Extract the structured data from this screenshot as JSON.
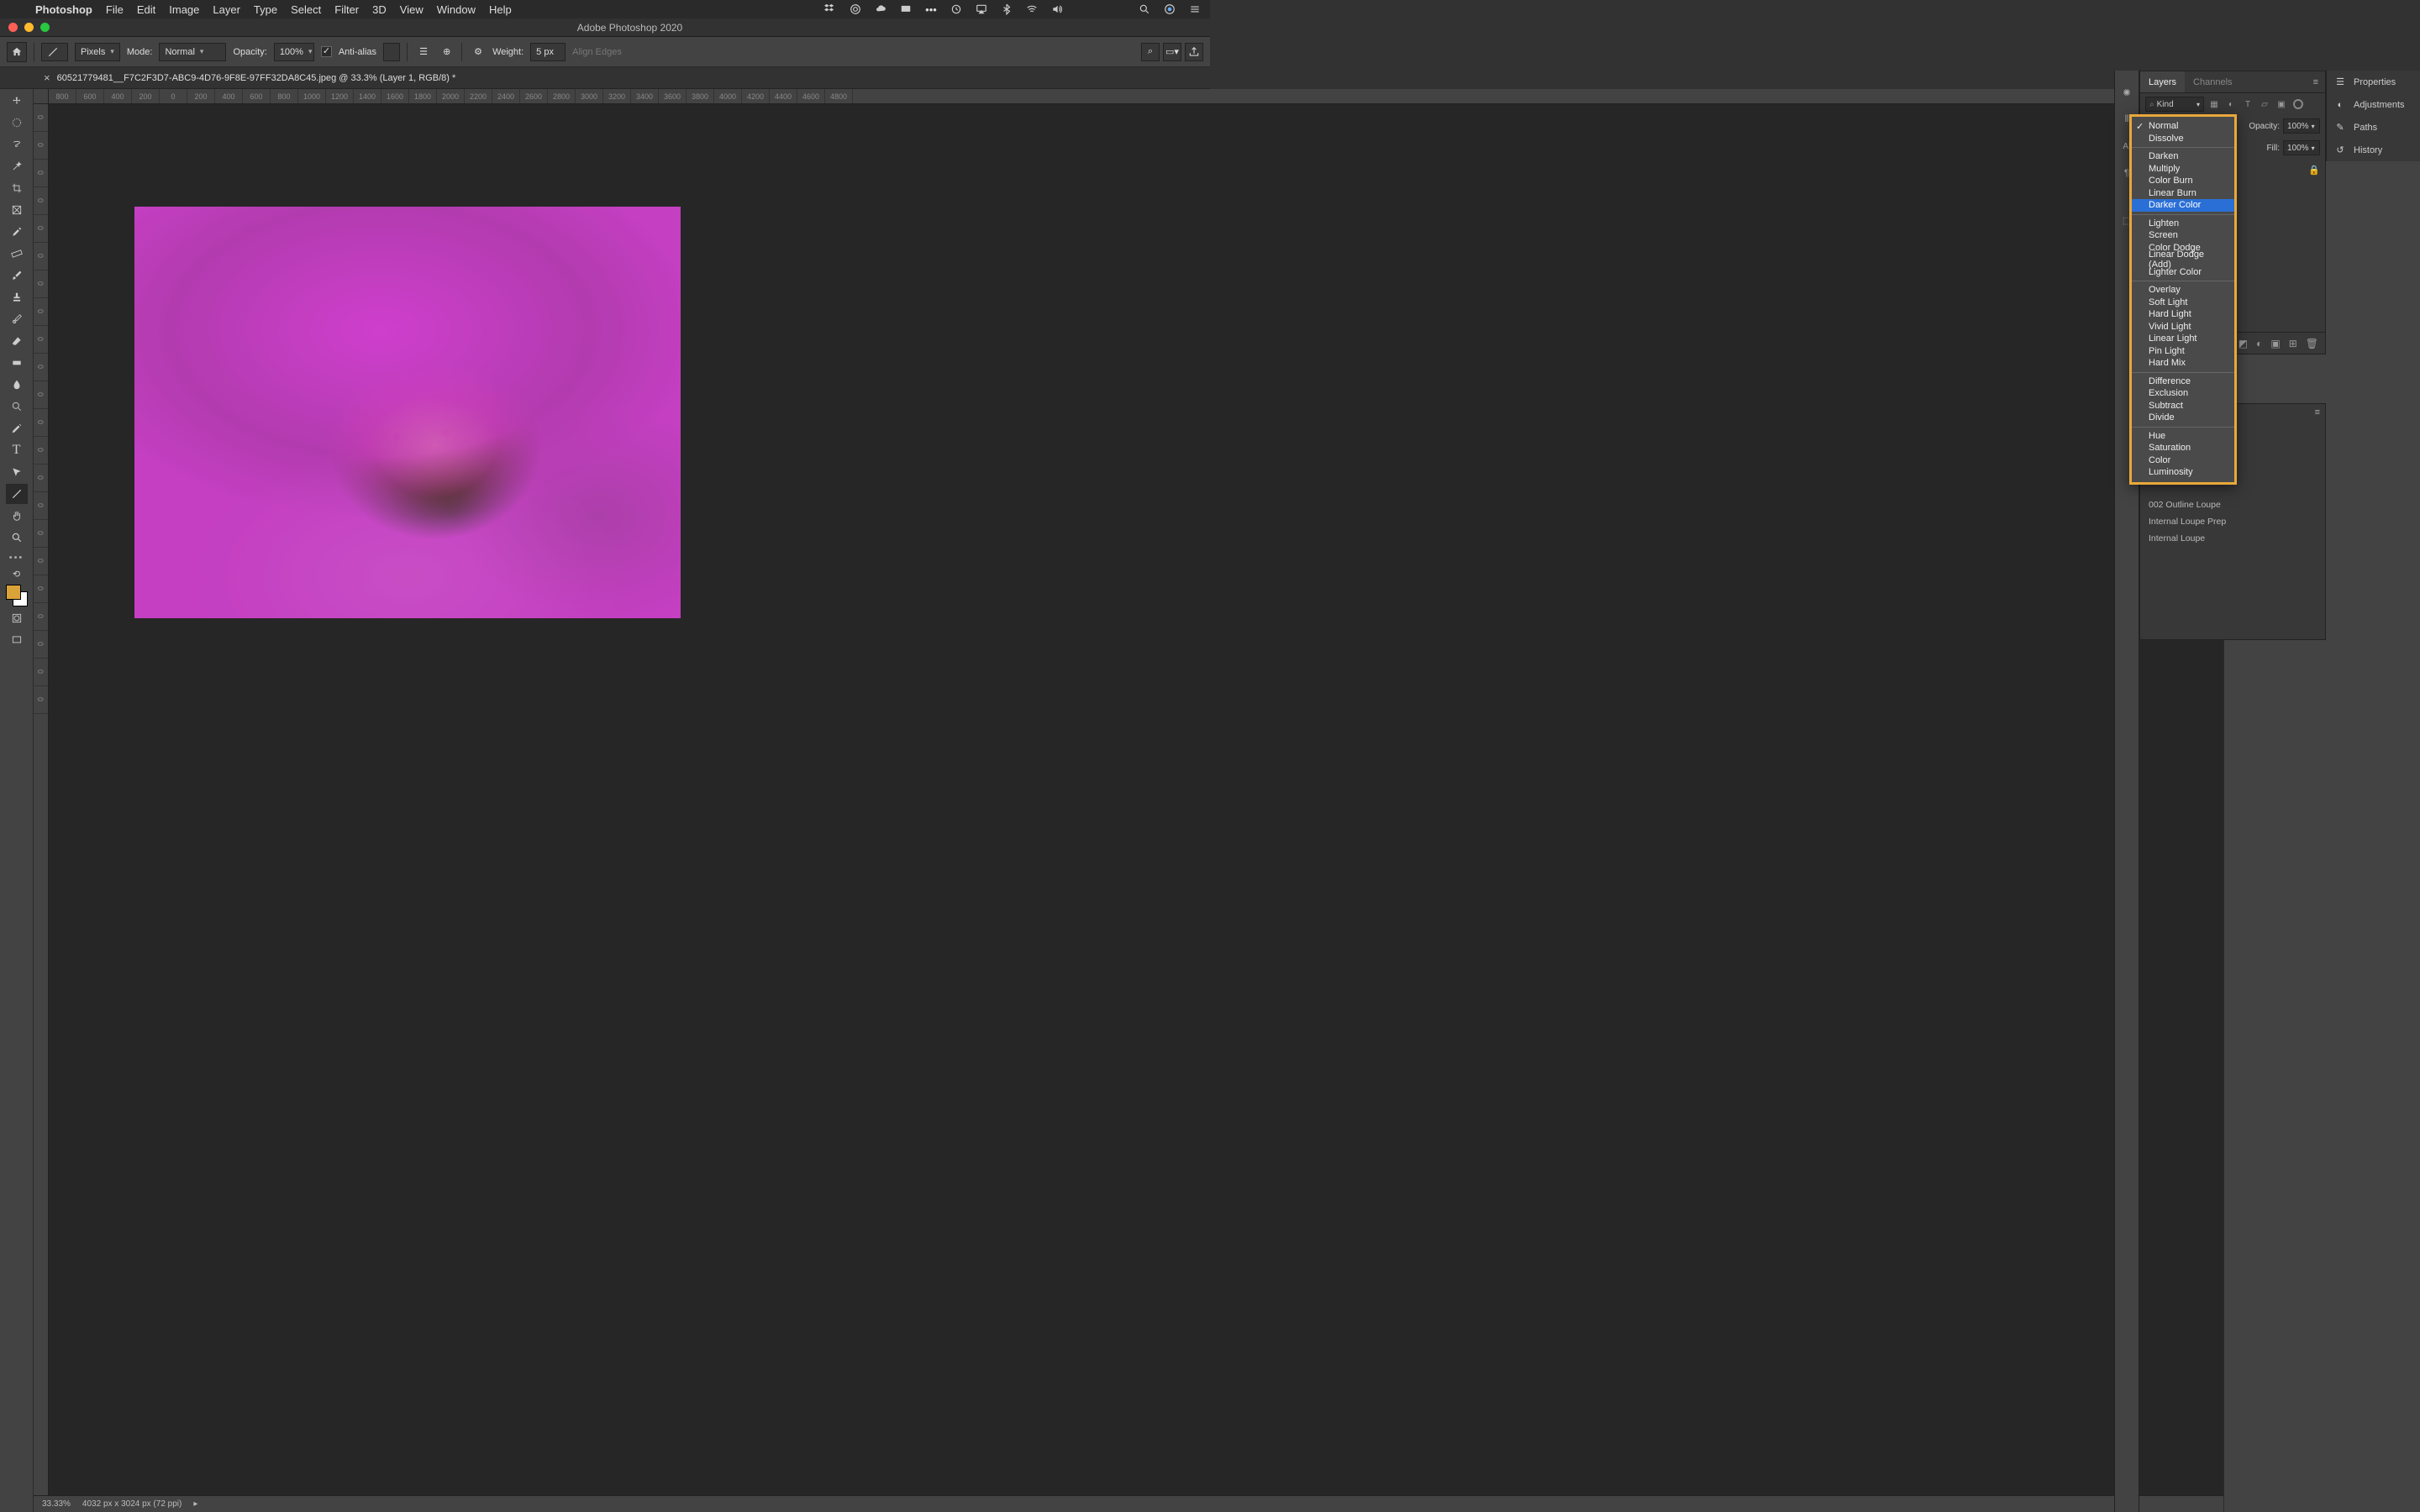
{
  "menubar": {
    "app": "Photoshop",
    "items": [
      "File",
      "Edit",
      "Image",
      "Layer",
      "Type",
      "Select",
      "Filter",
      "3D",
      "View",
      "Window",
      "Help"
    ]
  },
  "window": {
    "title": "Adobe Photoshop 2020"
  },
  "options": {
    "unit": "Pixels",
    "mode_label": "Mode:",
    "mode": "Normal",
    "opacity_label": "Opacity:",
    "opacity": "100%",
    "antialias": "Anti-alias",
    "weight_label": "Weight:",
    "weight": "5 px",
    "align": "Align Edges"
  },
  "document": {
    "tab": "60521779481__F7C2F3D7-ABC9-4D76-9F8E-97FF32DA8C45.jpeg @ 33.3% (Layer 1, RGB/8) *"
  },
  "ruler_h": [
    "800",
    "600",
    "400",
    "200",
    "0",
    "200",
    "400",
    "600",
    "800",
    "1000",
    "1200",
    "1400",
    "1600",
    "1800",
    "2000",
    "2200",
    "2400",
    "2600",
    "2800",
    "3000",
    "3200",
    "3400",
    "3600",
    "3800",
    "4000",
    "4200",
    "4400",
    "4600",
    "4800"
  ],
  "ruler_v": [
    "0",
    "0",
    "0",
    "0",
    "0",
    "0",
    "0",
    "0",
    "0",
    "0",
    "0",
    "0",
    "0",
    "0",
    "0",
    "0",
    "0",
    "0",
    "0",
    "0",
    "0",
    "0"
  ],
  "status": {
    "zoom": "33.33%",
    "dims": "4032 px x 3024 px (72 ppi)"
  },
  "layers": {
    "tab1": "Layers",
    "tab2": "Channels",
    "kind": "Kind",
    "opacity_label": "Opacity:",
    "opacity": "100%",
    "fill_label": "Fill:",
    "fill": "100%",
    "lock_label": "Lock:"
  },
  "far": {
    "p1": "Properties",
    "p2": "Adjustments",
    "p3": "Paths",
    "p4": "History"
  },
  "lower": {
    "i1": "002 Outline Loupe",
    "i2": "Internal Loupe Prep",
    "i3": "Internal Loupe"
  },
  "blend": {
    "groups": [
      [
        "Normal",
        "Dissolve"
      ],
      [
        "Darken",
        "Multiply",
        "Color Burn",
        "Linear Burn",
        "Darker Color"
      ],
      [
        "Lighten",
        "Screen",
        "Color Dodge",
        "Linear Dodge (Add)",
        "Lighter Color"
      ],
      [
        "Overlay",
        "Soft Light",
        "Hard Light",
        "Vivid Light",
        "Linear Light",
        "Pin Light",
        "Hard Mix"
      ],
      [
        "Difference",
        "Exclusion",
        "Subtract",
        "Divide"
      ],
      [
        "Hue",
        "Saturation",
        "Color",
        "Luminosity"
      ]
    ],
    "checked": "Normal",
    "highlighted": "Darker Color"
  }
}
